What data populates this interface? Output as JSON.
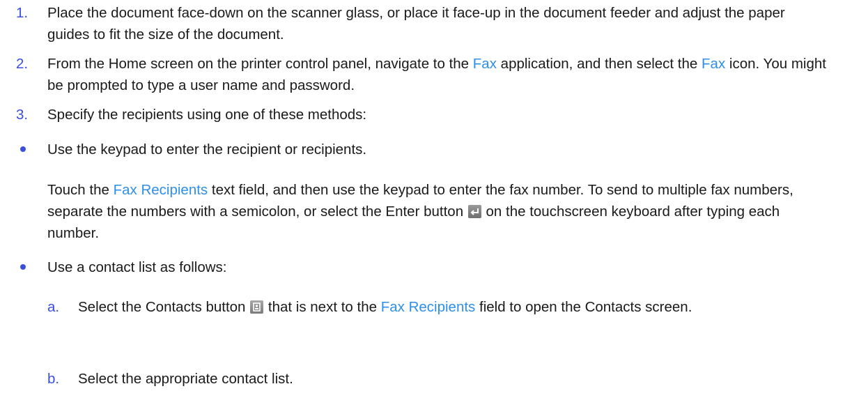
{
  "steps": [
    {
      "number": "1.",
      "text": "Place the document face-down on the scanner glass, or place it face-up in the document feeder and adjust the paper guides to fit the size of the document."
    },
    {
      "number": "2.",
      "text_before_1": "From the Home screen on the printer control panel, navigate to the ",
      "link_1": "Fax",
      "text_between": " application, and then select the ",
      "link_2": "Fax",
      "text_after": " icon. You might be prompted to type a user name and password."
    },
    {
      "number": "3.",
      "text": "Specify the recipients using one of these methods:"
    }
  ],
  "methods": [
    {
      "text": "Use the keypad to enter the recipient or recipients.",
      "detail_before": "Touch the ",
      "detail_link": "Fax Recipients",
      "detail_middle": " text field, and then use the keypad to enter the fax number. To send to multiple fax numbers, separate the numbers with a semicolon, or select the Enter button",
      "detail_after": "on the touchscreen keyboard after typing each number.",
      "icon": "enter-icon"
    },
    {
      "text": "Use a contact list as follows:"
    }
  ],
  "substeps": [
    {
      "letter": "a.",
      "text_before": "Select the Contacts button",
      "text_middle": "that is next to the ",
      "link": "Fax Recipients",
      "text_after": " field to open the Contacts screen.",
      "icon": "contacts-icon"
    },
    {
      "letter": "b.",
      "text": "Select the appropriate contact list."
    }
  ],
  "colors": {
    "step_number": "#3a4ee0",
    "ui_term": "#2f8fe8",
    "body_text": "#1a1a1a"
  }
}
